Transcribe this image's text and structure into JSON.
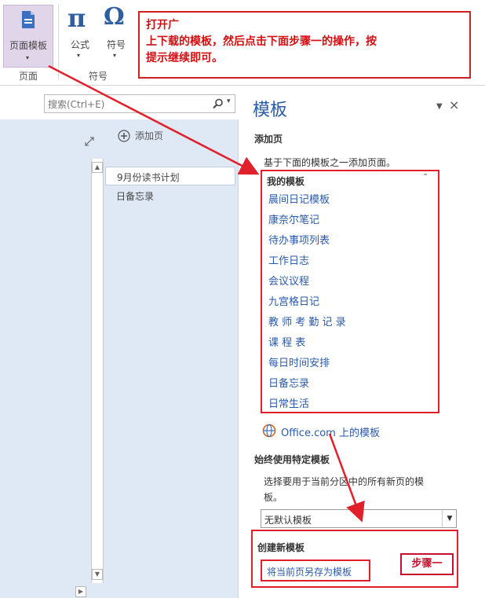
{
  "ribbon": {
    "page_template_label": "页面模板",
    "formula_label": "公式",
    "symbol_label": "符号",
    "group_page_label": "页面",
    "group_symbol_label": "符号",
    "pi_glyph": "π",
    "omega_glyph": "Ω"
  },
  "callout": {
    "line1": "打开广",
    "line2": "上下载的模板，然后点击下面步骤一的操作，按",
    "line3": "提示继续即可。"
  },
  "search": {
    "placeholder": "搜索(Ctrl+E)"
  },
  "pages": {
    "add_page_label": "添加页",
    "items": [
      "9月份读书计划",
      "日备忘录"
    ]
  },
  "template_pane": {
    "title": "模板",
    "add_page_heading": "添加页",
    "add_page_desc": "基于下面的模板之一添加页面。",
    "my_templates_heading": "我的模板",
    "templates": [
      "晨间日记模板",
      "康奈尔笔记",
      "待办事项列表",
      "工作日志",
      "会议议程",
      "九宫格日记",
      "教 师 考 勤 记 录",
      "课  程  表",
      "每日时间安排",
      "日备忘录",
      "日常生活"
    ],
    "office_link": "Office.com 上的模板",
    "always_use_heading": "始终使用特定模板",
    "always_use_desc_line1": "选择要用于当前分区中的所有新页的模",
    "always_use_desc_line2": "板。",
    "default_select": "无默认模板",
    "create_new_heading": "创建新模板",
    "save_as_template_link": "将当前页另存为模板",
    "step_label": "步骤一"
  },
  "colors": {
    "accent_red": "#e0202a",
    "link_blue": "#2a5aa8",
    "pane_blue": "#dfe9f5"
  }
}
